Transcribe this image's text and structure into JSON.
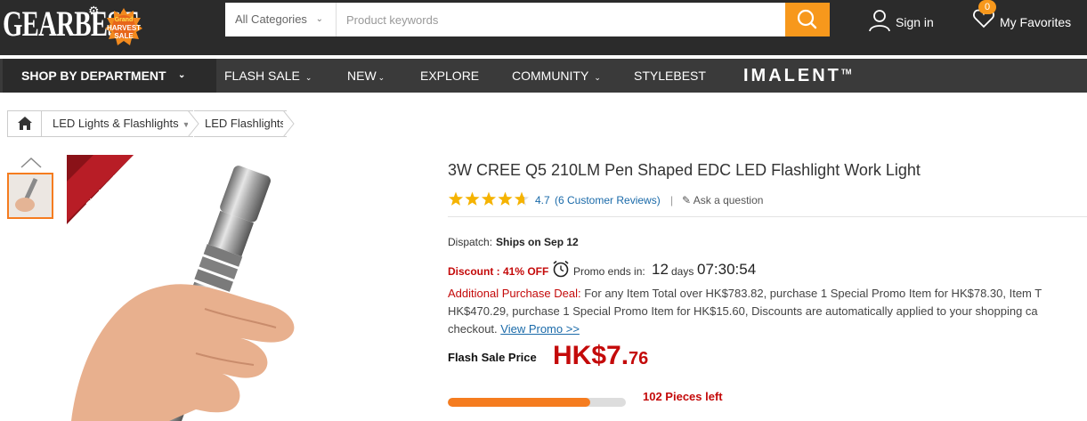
{
  "header": {
    "logo_text": "GEARBEST",
    "badge_line1": "Grand",
    "badge_line2": "HARVEST",
    "badge_line3": "SALE",
    "search": {
      "category": "All Categories",
      "placeholder": "Product keywords"
    },
    "sign_in": "Sign in",
    "favorites_label": "My Favorites",
    "favorites_count": "0"
  },
  "nav": {
    "shop_by_department": "SHOP BY DEPARTMENT",
    "items": [
      "FLASH SALE",
      "NEW",
      "EXPLORE",
      "COMMUNITY",
      "STYLEBEST"
    ],
    "brand": "IMALENT",
    "brand_mark": "TM"
  },
  "breadcrumb": {
    "items": [
      "LED Lights & Flashlights",
      "LED Flashlights"
    ]
  },
  "gallery": {
    "ribbon": "Flash Sale"
  },
  "product": {
    "title": "3W CREE Q5 210LM Pen Shaped EDC LED Flashlight Work Light",
    "rating": 4.7,
    "rating_text": "4.7",
    "reviews_text": "(6 Customer Reviews)",
    "separator": "|",
    "ask_question": "Ask a question",
    "dispatch_label": "Dispatch:",
    "dispatch_value": "Ships on Sep 12",
    "discount": "Discount : 41% OFF",
    "promo_label": "Promo ends in:",
    "promo_days": "12",
    "promo_days_label": "days",
    "promo_time": "07:30:54",
    "deal_label": "Additional Purchase Deal:",
    "deal_line1": " For any Item Total over HK$783.82, purchase 1 Special Promo Item for HK$78.30, Item T",
    "deal_line2": "HK$470.29, purchase 1 Special Promo Item for HK$15.60, Discounts are automatically applied to your shopping ca",
    "deal_line3": "checkout. ",
    "view_promo": "View Promo >>",
    "flash_sale_label": "Flash Sale Price",
    "price_main": "HK$7.",
    "price_cents": "76",
    "stock_fraction": 0.8,
    "pieces_left": "102 Pieces left"
  },
  "colors": {
    "header_bg": "#2b2b2b",
    "nav_bg": "#3a3a3a",
    "accent_orange": "#f7981c",
    "price_red": "#c40a0a",
    "link_blue": "#1a6aa9",
    "star_yellow": "#f5b301"
  }
}
